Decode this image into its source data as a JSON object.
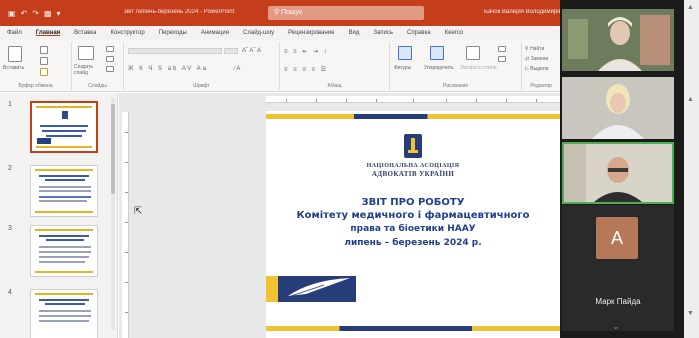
{
  "window": {
    "document_title": "звіт липень-березень 2024 - PowerPoint",
    "search_placeholder": "Пошук",
    "user_name": "Бачок Валерія Володимирівна"
  },
  "ribbon": {
    "tabs": [
      "Файл",
      "Главная",
      "Вставка",
      "Конструктор",
      "Переходы",
      "Анимация",
      "Слайд-шоу",
      "Рецензирование",
      "Вид",
      "Запись",
      "Справка",
      "Кeеrco"
    ],
    "active_tab": "Главная",
    "groups": {
      "clipboard": "Буфер обмена",
      "slides": "Слайды",
      "font": "Шрифт",
      "paragraph": "Абзац",
      "drawing": "Рисование",
      "editing": "Редактир"
    },
    "buttons": {
      "paste": "Вставить",
      "new_slide": "Создать слайд",
      "shapes": "Фигуры",
      "arrange": "Упорядочить",
      "quick_styles": "Экспресс-стили",
      "find": "Найти",
      "replace": "Замени",
      "select": "Выдели"
    }
  },
  "thumbnails": {
    "numbers": [
      "1",
      "2",
      "3",
      "4"
    ]
  },
  "slide": {
    "org_line1": "НАЦІОНАЛЬНА АСОЦІАЦІЯ",
    "org_line2": "АДВОКАТІВ УКРАЇНИ",
    "title_line1": "ЗВІТ ПРО РОБОТУ",
    "title_line2": "Комітету медичного і фармацевтичного",
    "title_line3": "права та біоетики НААУ",
    "title_line4": "липень – березень 2024 р.",
    "colors": {
      "navy": "#263d7a",
      "gold": "#f1c232",
      "title_blue": "#1f3f8f"
    }
  },
  "video_panel": {
    "avatar_letter": "А",
    "participant_name": "Марк Пайда",
    "active_speaker_color": "#4caf50",
    "avatar_color": "#b7785a"
  },
  "colors": {
    "accent": "#c43e1c"
  }
}
